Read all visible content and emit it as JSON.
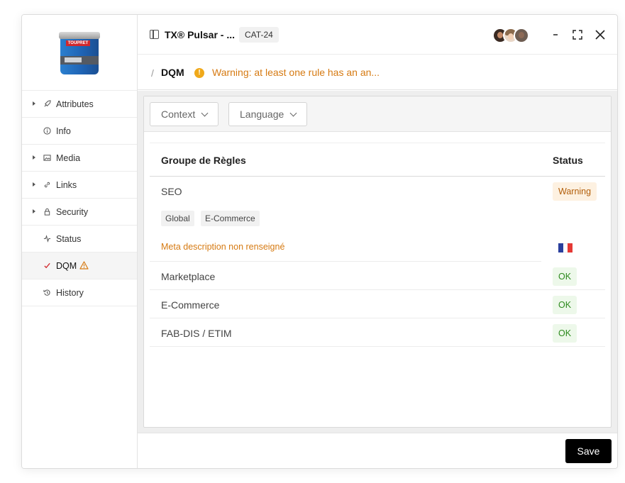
{
  "window": {
    "title": "TX® Pulsar - ...",
    "tag": "CAT-24"
  },
  "product": {
    "brand_text": "TOUPRET"
  },
  "sidebar": {
    "items": [
      {
        "label": "Attributes",
        "icon": "rocket-icon",
        "expandable": true
      },
      {
        "label": "Info",
        "icon": "info-icon",
        "expandable": false
      },
      {
        "label": "Media",
        "icon": "image-icon",
        "expandable": true
      },
      {
        "label": "Links",
        "icon": "link-icon",
        "expandable": true
      },
      {
        "label": "Security",
        "icon": "lock-icon",
        "expandable": true
      },
      {
        "label": "Status",
        "icon": "activity-icon",
        "expandable": false
      },
      {
        "label": "DQM",
        "icon": "check-icon",
        "expandable": false,
        "active": true,
        "warning": true
      },
      {
        "label": "History",
        "icon": "history-icon",
        "expandable": false
      }
    ]
  },
  "subheader": {
    "title": "DQM",
    "warning": "Warning: at least one rule has an an..."
  },
  "filters": {
    "context": "Context",
    "language": "Language"
  },
  "table": {
    "headers": {
      "name": "Groupe de Règles",
      "status": "Status"
    },
    "seo": {
      "name": "SEO",
      "status": "Warning",
      "chips": [
        "Global",
        "E-Commerce"
      ],
      "rule": "Meta description non renseigné",
      "flag": "french-flag-icon"
    },
    "rows": [
      {
        "name": "Marketplace",
        "status": "OK"
      },
      {
        "name": "E-Commerce",
        "status": "OK"
      },
      {
        "name": "FAB-DIS / ETIM",
        "status": "OK"
      }
    ]
  },
  "footer": {
    "save_label": "Save"
  },
  "colors": {
    "warning_text": "#d67a12",
    "ok_text": "#2e8a1e",
    "primary_button": "#000000"
  }
}
